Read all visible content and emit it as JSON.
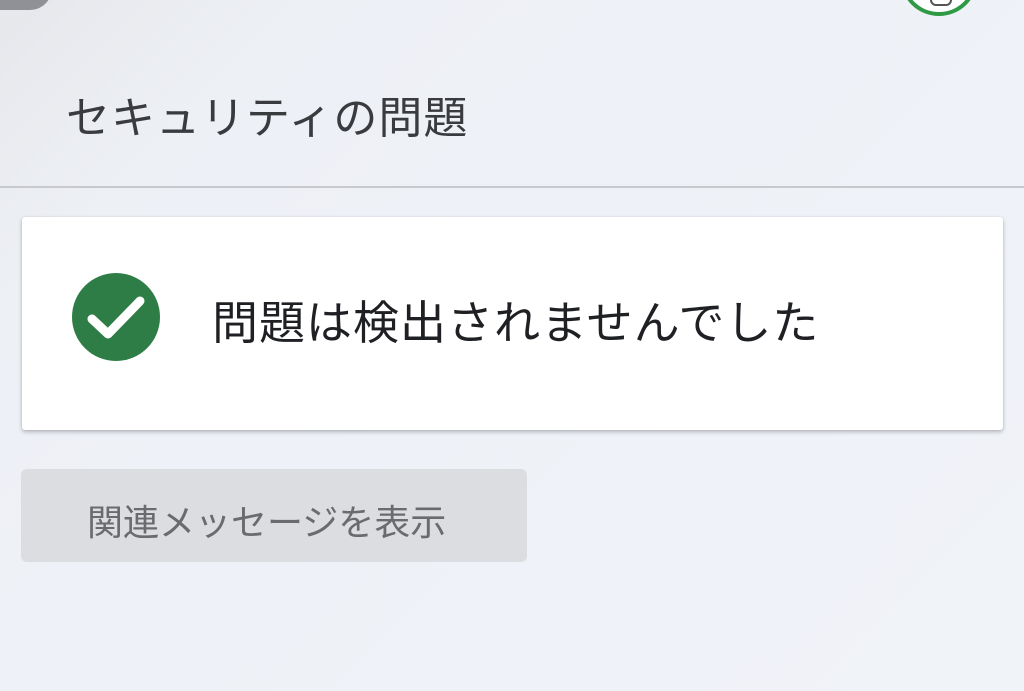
{
  "header": {
    "title": "セキュリティの問題"
  },
  "result": {
    "status_icon": "check-circle-icon",
    "message": "問題は検出されませんでした",
    "status_color": "#2e7d46"
  },
  "actions": {
    "related_messages_label": "関連メッセージを表示"
  }
}
